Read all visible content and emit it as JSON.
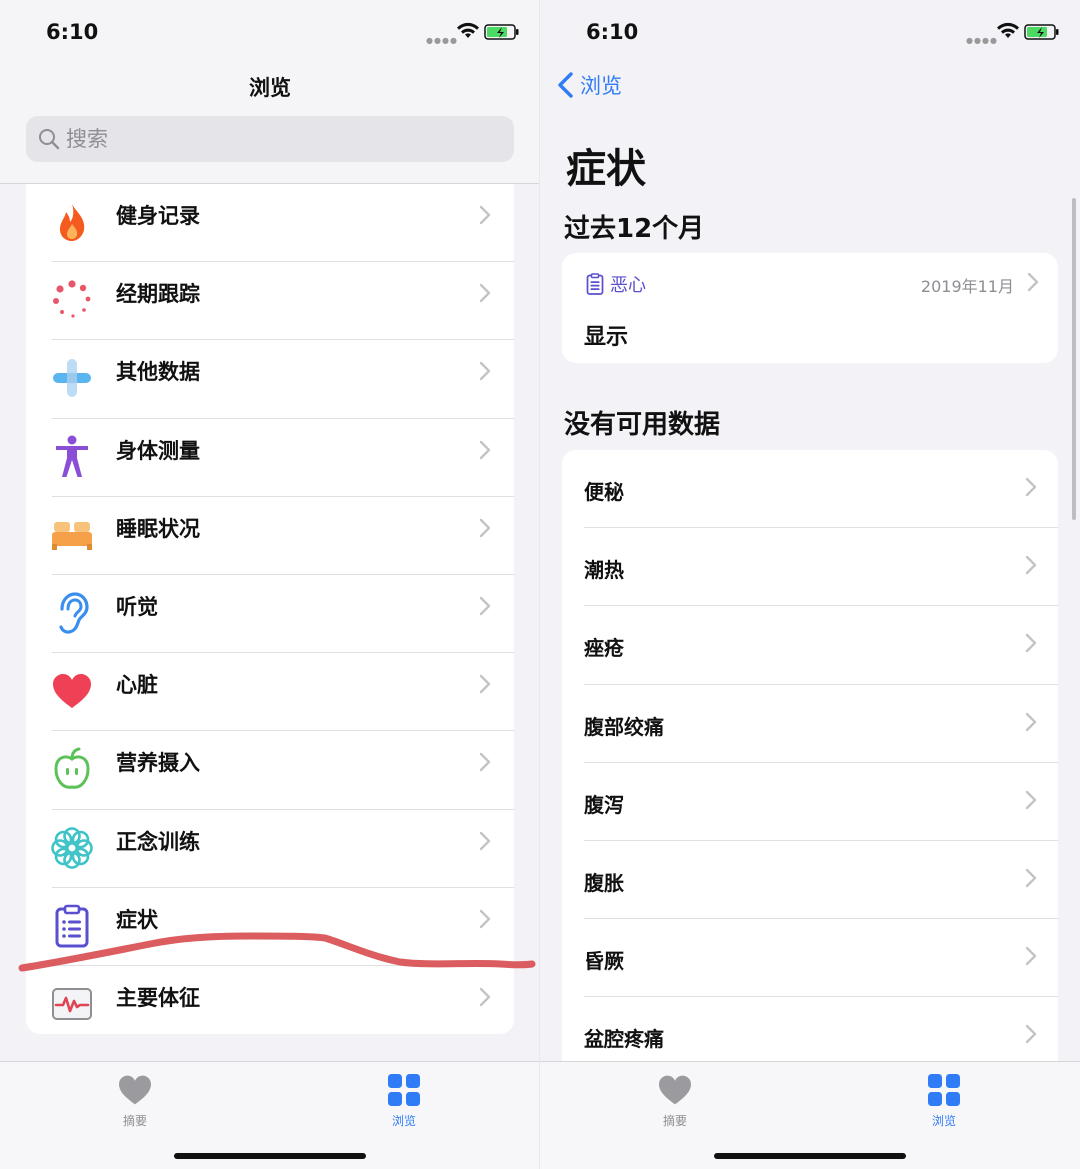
{
  "left": {
    "status_time": "6:10",
    "nav_title": "浏览",
    "search": {
      "placeholder": "搜索"
    },
    "categories": [
      {
        "label": "健身记录",
        "icon": "flame-icon",
        "color": "#f55a1e"
      },
      {
        "label": "经期跟踪",
        "icon": "cycle-dots-icon",
        "color": "#e8566b"
      },
      {
        "label": "其他数据",
        "icon": "plus-cross-icon",
        "color": "#5ab4f0"
      },
      {
        "label": "身体测量",
        "icon": "person-figure-icon",
        "color": "#8a4fd6"
      },
      {
        "label": "睡眠状况",
        "icon": "bed-icon",
        "color": "#f4a14a"
      },
      {
        "label": "听觉",
        "icon": "ear-icon",
        "color": "#3a8ef0"
      },
      {
        "label": "心脏",
        "icon": "heart-icon",
        "color": "#ee4156"
      },
      {
        "label": "营养摄入",
        "icon": "apple-icon",
        "color": "#5cc25a"
      },
      {
        "label": "正念训练",
        "icon": "flower-icon",
        "color": "#3ec3c7"
      },
      {
        "label": "症状",
        "icon": "clipboard-icon",
        "color": "#5a4fcf"
      },
      {
        "label": "主要体征",
        "icon": "vitals-icon",
        "color": "#e04353"
      }
    ]
  },
  "right": {
    "status_time": "6:10",
    "back_label": "浏览",
    "page_title": "症状",
    "past_section": "过去12个月",
    "log_entry": {
      "name": "恶心",
      "date": "2019年11月",
      "value": "显示"
    },
    "no_data_section": "没有可用数据",
    "symptoms": [
      "便秘",
      "潮热",
      "痤疮",
      "腹部绞痛",
      "腹泻",
      "腹胀",
      "昏厥",
      "盆腔疼痛"
    ]
  },
  "tabbar": {
    "summary_label": "摘要",
    "browse_label": "浏览"
  },
  "colors": {
    "accent": "#2f7cf6",
    "symptom_purple": "#5a4fcf",
    "annotation_red": "#d84b4f"
  }
}
